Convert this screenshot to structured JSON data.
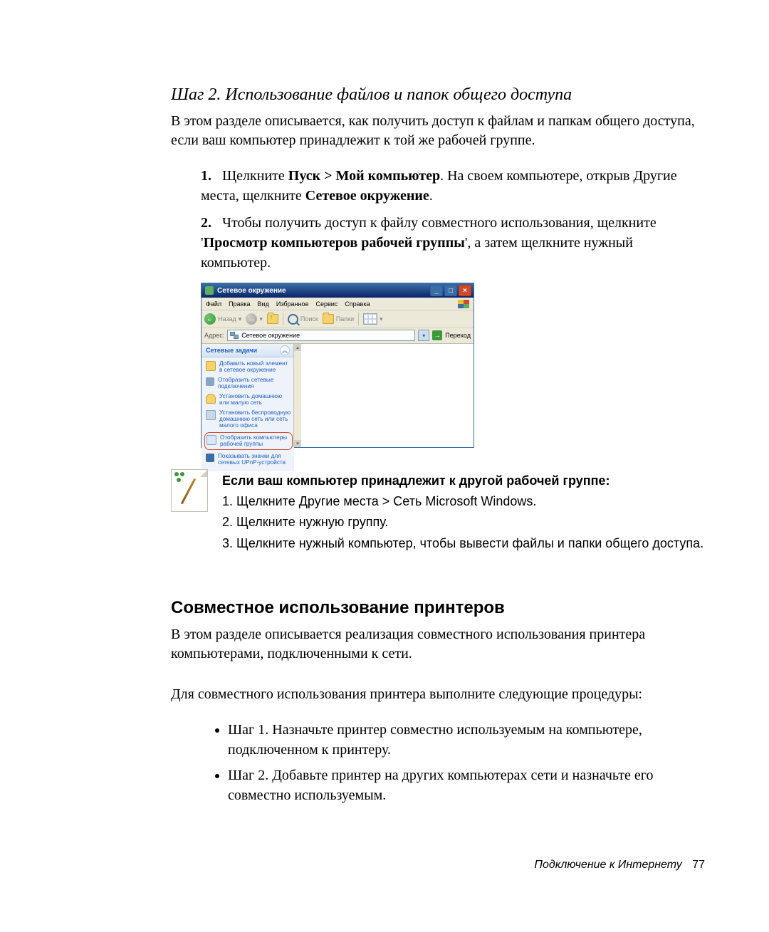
{
  "step_title": "Шаг 2. Использование файлов и папок общего доступа",
  "intro": "В этом разделе описывается, как получить доступ к файлам и папкам общего доступа, если ваш компьютер принадлежит к той же рабочей группе.",
  "list1": {
    "n1": "1.",
    "item1_a": "Щелкните ",
    "item1_b": "Пуск > Мой компьютер",
    "item1_c": ". На своем компьютере, открыв Другие места, щелкните ",
    "item1_d": "Сетевое окружение",
    "item1_e": ".",
    "n2": "2.",
    "item2_a": "Чтобы получить доступ к файлу совместного использования, щелкните '",
    "item2_b": "Просмотр компьютеров рабочей группы",
    "item2_c": "', а затем щелкните нужный компьютер."
  },
  "xp": {
    "title": "Сетевое окружение",
    "menu": {
      "file": "Файл",
      "edit": "Правка",
      "view": "Вид",
      "fav": "Избранное",
      "tools": "Сервис",
      "help": "Справка"
    },
    "toolbar": {
      "back": "Назад",
      "search": "Поиск",
      "folders": "Папки"
    },
    "addrlabel": "Адрес:",
    "addrval": "Сетевое окружение",
    "go": "Переход",
    "panel": "Сетевые задачи",
    "tasks": {
      "t1": "Добавить новый элемент в сетевое окружение",
      "t2": "Отобразить сетевые подключения",
      "t3": "Установить домашнюю или малую сеть",
      "t4": "Установить беспроводную домашнюю сеть или сеть малого офиса",
      "t5": "Отобразить компьютеры рабочей группы",
      "t6": "Показывать значки для сетевых UPnP-устройств"
    }
  },
  "note": {
    "heading": "Если ваш компьютер принадлежит к другой рабочей группе:",
    "n1": "1. Щелкните Другие места > Сеть Microsoft Windows.",
    "n2": "2. Щелкните нужную группу.",
    "n3": "3. Щелкните нужный компьютер, чтобы вывести файлы и папки общего доступа."
  },
  "section2": "Совместное использование принтеров",
  "sec2_p1": "В этом разделе описывается реализация совместного использования принтера компьютерами, подключенными к сети.",
  "sec2_p2": "Для совместного использования принтера выполните следующие процедуры:",
  "bullets": {
    "b1": "Шаг 1. Назначьте принтер совместно используемым на компьютере, подключенном к принтеру.",
    "b2": "Шаг 2. Добавьте принтер на других компьютерах сети и назначьте его совместно используемым."
  },
  "footer": {
    "text": "Подключение к Интернету",
    "page": "77"
  }
}
